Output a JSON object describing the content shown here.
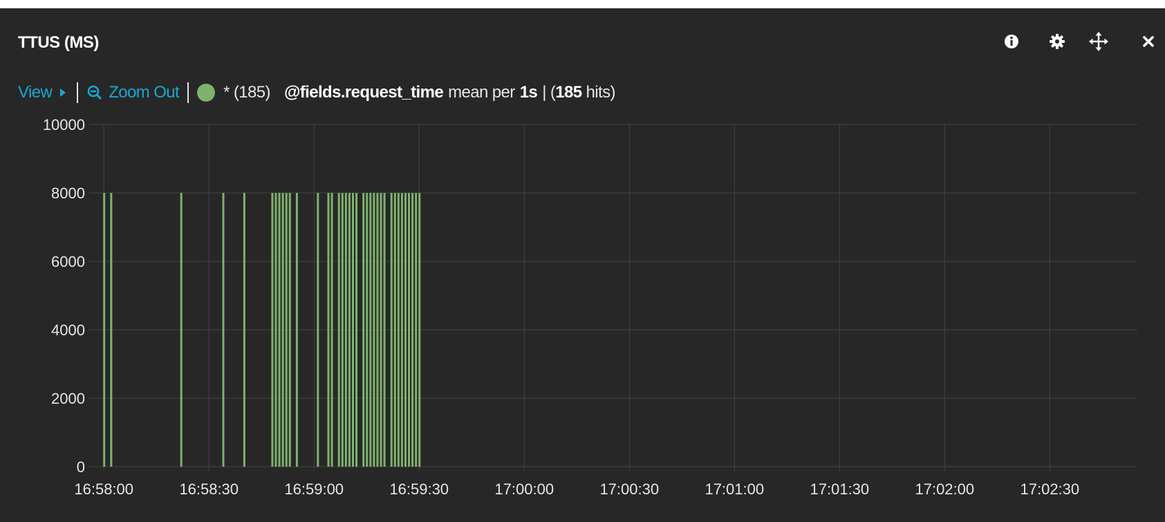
{
  "panel": {
    "title": "TTUS (MS)",
    "icons": [
      "info-icon",
      "gear-icon",
      "move-icon",
      "close-icon"
    ]
  },
  "toolbar": {
    "view_label": "View",
    "zoom_out_label": "Zoom Out",
    "legend_label": "* (185)",
    "field": "@fields.request_time",
    "mode_text": "mean per",
    "interval": "1s",
    "hits_prefix": "| (",
    "hits_count": "185",
    "hits_suffix": "hits)"
  },
  "colors": {
    "background": "#272727",
    "series": "#7eb26d",
    "link": "#1ba6d6"
  },
  "chart_data": {
    "type": "bar",
    "series": [
      {
        "name": "* (185)",
        "color": "#7eb26d",
        "points": [
          {
            "t": "16:58:00",
            "v": 8000
          },
          {
            "t": "16:58:02",
            "v": 8000
          },
          {
            "t": "16:58:22",
            "v": 8000
          },
          {
            "t": "16:58:34",
            "v": 8000
          },
          {
            "t": "16:58:40",
            "v": 8000
          },
          {
            "t": "16:58:48",
            "v": 8000
          },
          {
            "t": "16:58:49",
            "v": 8000
          },
          {
            "t": "16:58:50",
            "v": 8000
          },
          {
            "t": "16:58:51",
            "v": 8000
          },
          {
            "t": "16:58:52",
            "v": 8000
          },
          {
            "t": "16:58:53",
            "v": 8000
          },
          {
            "t": "16:58:55",
            "v": 8000
          },
          {
            "t": "16:59:01",
            "v": 8000
          },
          {
            "t": "16:59:04",
            "v": 8000
          },
          {
            "t": "16:59:05",
            "v": 8000
          },
          {
            "t": "16:59:07",
            "v": 8000
          },
          {
            "t": "16:59:08",
            "v": 8000
          },
          {
            "t": "16:59:09",
            "v": 8000
          },
          {
            "t": "16:59:10",
            "v": 8000
          },
          {
            "t": "16:59:11",
            "v": 8000
          },
          {
            "t": "16:59:12",
            "v": 8000
          },
          {
            "t": "16:59:14",
            "v": 8000
          },
          {
            "t": "16:59:15",
            "v": 8000
          },
          {
            "t": "16:59:16",
            "v": 8000
          },
          {
            "t": "16:59:17",
            "v": 8000
          },
          {
            "t": "16:59:18",
            "v": 8000
          },
          {
            "t": "16:59:19",
            "v": 8000
          },
          {
            "t": "16:59:20",
            "v": 8000
          },
          {
            "t": "16:59:22",
            "v": 8000
          },
          {
            "t": "16:59:23",
            "v": 8000
          },
          {
            "t": "16:59:24",
            "v": 8000
          },
          {
            "t": "16:59:25",
            "v": 8000
          },
          {
            "t": "16:59:26",
            "v": 8000
          },
          {
            "t": "16:59:27",
            "v": 8000
          },
          {
            "t": "16:59:28",
            "v": 8000
          },
          {
            "t": "16:59:29",
            "v": 8000
          },
          {
            "t": "16:59:30",
            "v": 8000
          }
        ]
      }
    ],
    "x_ticks": [
      "16:58:00",
      "16:58:30",
      "16:59:00",
      "16:59:30",
      "17:00:00",
      "17:00:30",
      "17:01:00",
      "17:01:30",
      "17:02:00",
      "17:02:30"
    ],
    "x_range": [
      "16:57:57",
      "17:02:55"
    ],
    "y_ticks": [
      0,
      2000,
      4000,
      6000,
      8000,
      10000
    ],
    "ylim": [
      0,
      10000
    ],
    "grid": true,
    "title": "",
    "xlabel": "",
    "ylabel": ""
  }
}
